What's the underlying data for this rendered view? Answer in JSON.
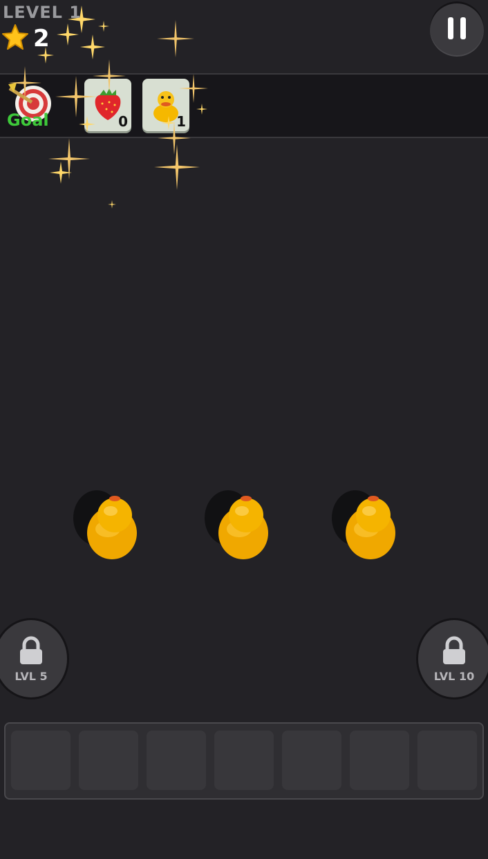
{
  "hud": {
    "level_label": "LEVEL 1",
    "stars": "2",
    "pause_icon": "pause-icon"
  },
  "goal": {
    "label": "Goal",
    "icon": "target-icon",
    "items": [
      {
        "name": "strawberry",
        "icon": "strawberry-icon",
        "count": "0"
      },
      {
        "name": "duck",
        "icon": "duck-icon",
        "count": "1"
      }
    ]
  },
  "board": {
    "items": [
      "duck",
      "duck",
      "duck"
    ]
  },
  "locked_slots": [
    {
      "label": "LVL 5",
      "icon": "lock-icon"
    },
    {
      "label": "LVL 10",
      "icon": "lock-icon"
    }
  ],
  "tray": {
    "slots": 7
  },
  "colors": {
    "background": "#232226",
    "goal_green": "#3ec93a",
    "duck_yellow": "#f5b800",
    "star_yellow": "#ffc21a"
  }
}
